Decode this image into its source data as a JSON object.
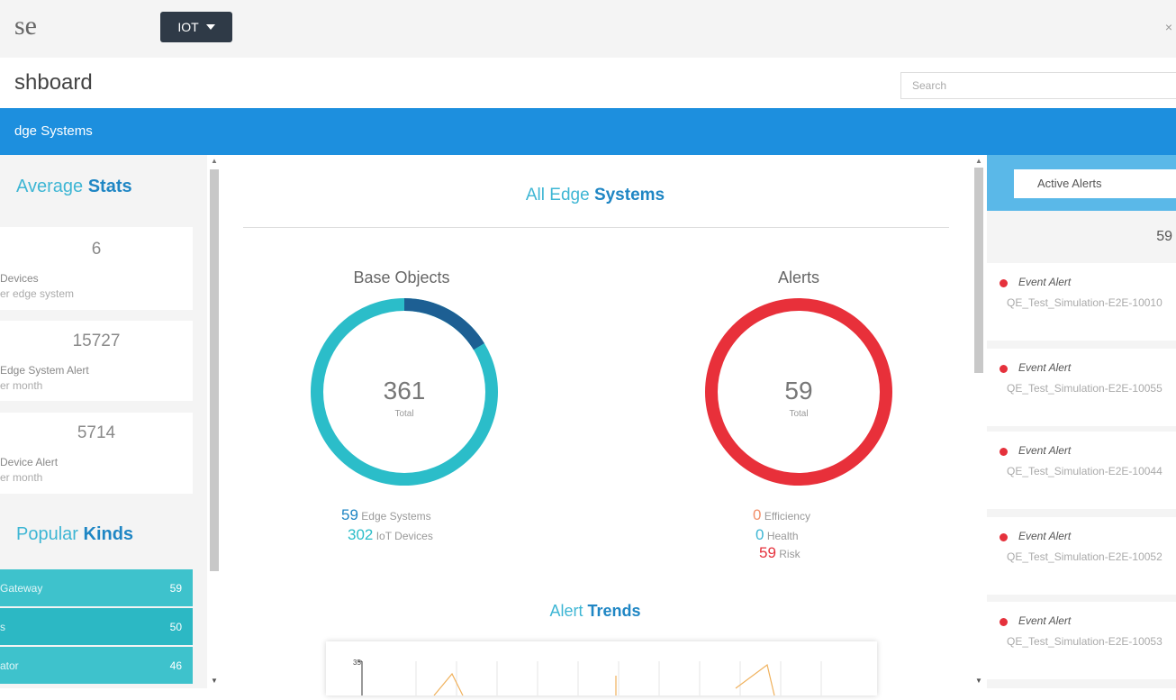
{
  "app": {
    "brand_fragment": "se",
    "env_button": "IOT",
    "page_title": "shboard",
    "search_placeholder": "Search",
    "nav_label": "dge Systems"
  },
  "left": {
    "avg_title_a": "Average",
    "avg_title_b": "Stats",
    "stats": [
      {
        "value": "6",
        "label": "Devices",
        "sub": "er edge system"
      },
      {
        "value": "15727",
        "label": "Edge System Alert",
        "sub": "er month"
      },
      {
        "value": "5714",
        "label": "Device Alert",
        "sub": "er month"
      }
    ],
    "kinds_title_a": "Popular",
    "kinds_title_b": "Kinds",
    "kinds": [
      {
        "name": "Gateway",
        "count": "59",
        "color": "#3ec2cc"
      },
      {
        "name": "s",
        "count": "50",
        "color": "#2cb8c4"
      },
      {
        "name": "ator",
        "count": "46",
        "color": "#3ec2cc"
      }
    ]
  },
  "center": {
    "title_a": "All Edge",
    "title_b": "Systems",
    "base": {
      "title": "Base Objects",
      "total": "361",
      "total_label": "Total",
      "edge_systems_count": "59",
      "edge_systems_label": "Edge Systems",
      "iot_devices_count": "302",
      "iot_devices_label": "IoT Devices",
      "colors": {
        "iot": "#2bbdc9",
        "edge": "#1d5f93"
      },
      "edge_fraction": 0.163
    },
    "alerts": {
      "title": "Alerts",
      "total": "59",
      "total_label": "Total",
      "efficiency_count": "0",
      "efficiency_label": "Efficiency",
      "health_count": "0",
      "health_label": "Health",
      "risk_count": "59",
      "risk_label": "Risk",
      "colors": {
        "ring": "#e8303a",
        "efficiency": "#f2906b",
        "health": "#3eb6d4",
        "risk": "#e5313c"
      }
    },
    "trend_title_a": "Alert",
    "trend_title_b": "Trends",
    "trend_y_top": "35"
  },
  "right": {
    "select_label": "Active Alerts",
    "count": "59",
    "alerts": [
      {
        "type": "Event Alert",
        "desc": "QE_Test_Simulation-E2E-10010"
      },
      {
        "type": "Event Alert",
        "desc": "QE_Test_Simulation-E2E-10055"
      },
      {
        "type": "Event Alert",
        "desc": "QE_Test_Simulation-E2E-10044"
      },
      {
        "type": "Event Alert",
        "desc": "QE_Test_Simulation-E2E-10052"
      },
      {
        "type": "Event Alert",
        "desc": "QE_Test_Simulation-E2E-10053"
      }
    ]
  }
}
